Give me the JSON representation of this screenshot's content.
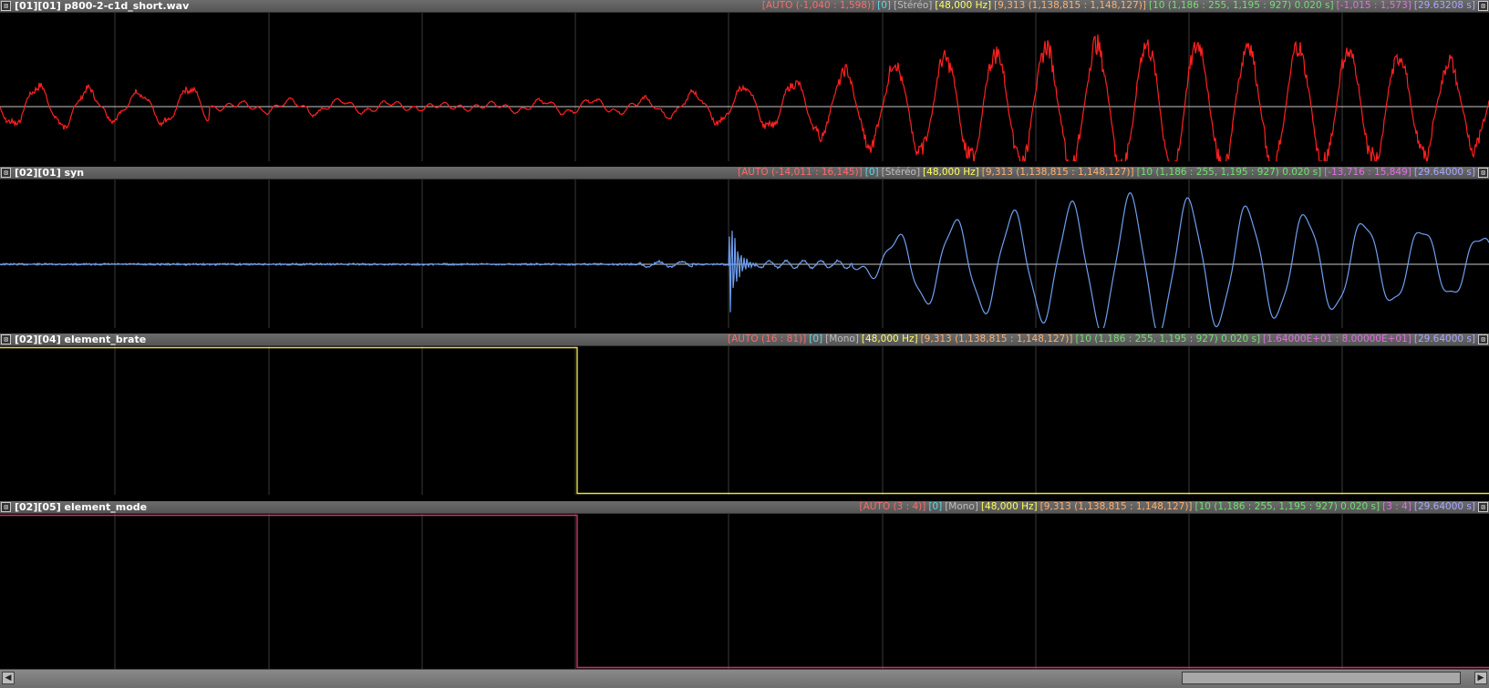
{
  "tracks": [
    {
      "name": "[01][01] p800-2-c1d_short.wav",
      "color": "#ff2020",
      "info": {
        "auto": "[AUTO (-1,040 : 1,598)]",
        "index": "[0]",
        "channels": "[Stéréo]",
        "rate": "[48,000 Hz]",
        "range": "[9,313 (1,138,815 : 1,148,127)]",
        "step": "[10 (1,186 : 255, 1,195 : 927) 0.020 s]",
        "values": "[-1,015 : 1,573]",
        "duration": "[29.63208 s]"
      }
    },
    {
      "name": "[02][01] syn",
      "color": "#6f9ff0",
      "info": {
        "auto": "[AUTO (-14,011 : 16,145)]",
        "index": "[0]",
        "channels": "[Stéréo]",
        "rate": "[48,000 Hz]",
        "range": "[9,313 (1,138,815 : 1,148,127)]",
        "step": "[10 (1,186 : 255, 1,195 : 927) 0.020 s]",
        "values": "[-13,716 : 15,849]",
        "duration": "[29.64000 s]"
      }
    },
    {
      "name": "[02][04] element_brate",
      "color": "#e6e040",
      "info": {
        "auto": "[AUTO (16 : 81)]",
        "index": "[0]",
        "channels": "[Mono]",
        "rate": "[48,000 Hz]",
        "range": "[9,313 (1,138,815 : 1,148,127)]",
        "step": "[10 (1,186 : 255, 1,195 : 927) 0.020 s]",
        "values": "[1.64000E+01 : 8.00000E+01]",
        "duration": "[29.64000 s]"
      }
    },
    {
      "name": "[02][05] element_mode",
      "color": "#d0306a",
      "info": {
        "auto": "[AUTO (3 : 4)]",
        "index": "[0]",
        "channels": "[Mono]",
        "rate": "[48,000 Hz]",
        "range": "[9,313 (1,138,815 : 1,148,127)]",
        "step": "[10 (1,186 : 255, 1,195 : 927) 0.020 s]",
        "values": "[3 : 4]",
        "duration": "[29.64000 s]"
      }
    }
  ],
  "info_colors": {
    "auto": "#ff6a6a",
    "index": "#5fd8e8",
    "channels": "#bdbdbd",
    "rate": "#ffff60",
    "range": "#ffb070",
    "step": "#70e070",
    "values": "#e070e0",
    "duration": "#a8a8ff"
  },
  "icons": {
    "track_toggle": "⊠",
    "track_close": "⊠",
    "scroll_left": "◀",
    "scroll_right": "▶"
  },
  "view": {
    "step_change_fraction": 0.3876,
    "scroll_thumb_start": 0.8,
    "scroll_thumb_end": 0.992
  }
}
